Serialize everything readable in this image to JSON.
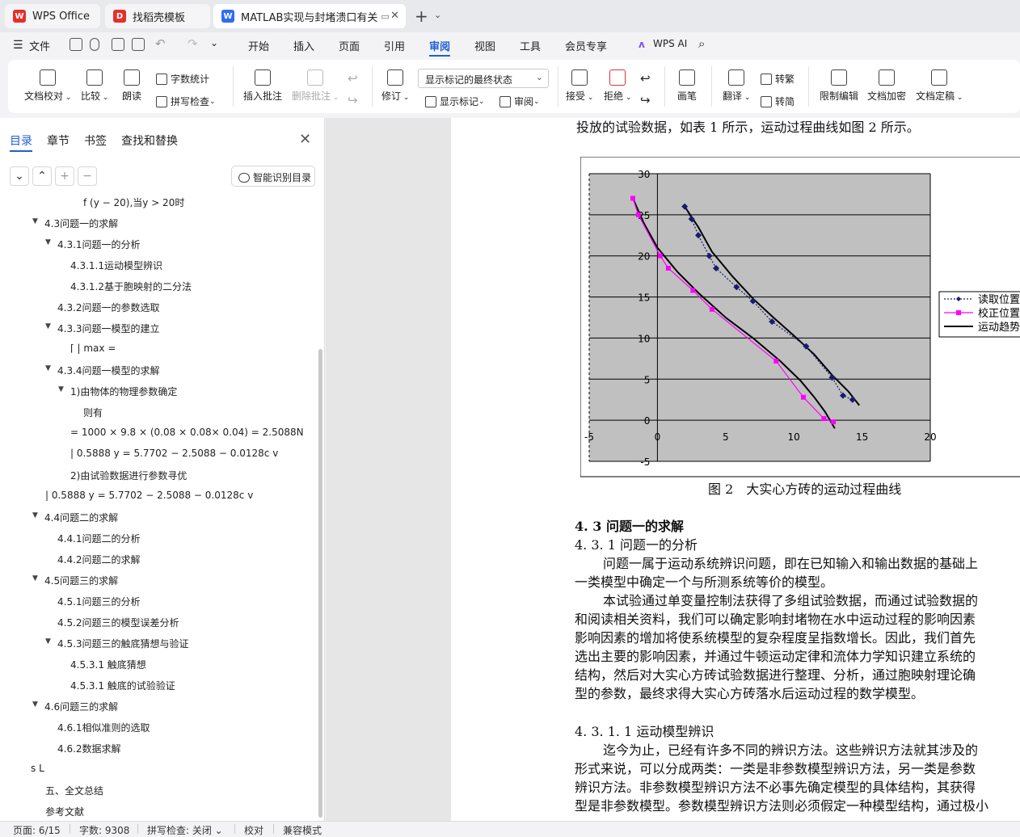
{
  "tabs": [
    {
      "label": "WPS Office",
      "color": "#e5302a"
    },
    {
      "label": "找稻壳模板",
      "color": "#e5302a"
    },
    {
      "label": "MATLAB实现与封堵溃口有关",
      "color": "#2f6cf6"
    }
  ],
  "menu": {
    "file": "文件",
    "items": [
      "开始",
      "插入",
      "页面",
      "引用",
      "审阅",
      "视图",
      "工具",
      "会员专享"
    ],
    "active": "审阅",
    "wps_ai": "WPS AI"
  },
  "ribbon": {
    "doc_check": "文档校对",
    "compare": "比较",
    "read_aloud": "朗读",
    "word_count": "字数统计",
    "spell_check": "拼写检查",
    "insert_comment": "插入批注",
    "delete_comment": "删除批注",
    "revise": "修订",
    "markup_state": "显示标记的最终状态",
    "show_markup": "显示标记",
    "review": "审阅",
    "accept": "接受",
    "reject": "拒绝",
    "pen": "画笔",
    "translate": "翻译",
    "to_trad": "转繁",
    "to_simp": "转简",
    "restrict_edit": "限制编辑",
    "encrypt": "文档加密",
    "finalize": "文档定稿"
  },
  "nav": {
    "tabs": [
      "目录",
      "章节",
      "书签",
      "查找和替换"
    ],
    "active_tab": "目录",
    "smart_toc": "智能识别目录",
    "items": [
      {
        "text": "f (y − 20),当y > 20时",
        "level": 4,
        "arrow": false
      },
      {
        "text": "4.3问题一的求解",
        "level": 1,
        "arrow": true
      },
      {
        "text": "4.3.1问题一的分析",
        "level": 2,
        "arrow": true
      },
      {
        "text": "4.3.1.1运动模型辨识",
        "level": 3,
        "arrow": false
      },
      {
        "text": "4.3.1.2基于胞映射的二分法",
        "level": 3,
        "arrow": false
      },
      {
        "text": "4.3.2问题一的参数选取",
        "level": 2,
        "arrow": false
      },
      {
        "text": "4.3.3问题一模型的建立",
        "level": 2,
        "arrow": true
      },
      {
        "text": "⌈ |    max =",
        "level": 3,
        "arrow": false
      },
      {
        "text": "4.3.4问题一模型的求解",
        "level": 2,
        "arrow": true
      },
      {
        "text": "1)由物体的物理参数确定",
        "level": 3,
        "arrow": true
      },
      {
        "text": "则有",
        "level": 4,
        "arrow": false
      },
      {
        "text": "= 1000 × 9.8 × (0.08 × 0.08× 0.04) = 2.5088N",
        "level": 3,
        "arrow": false
      },
      {
        "text": "|  0.5888  y = 5.7702 − 2.5088 − 0.0128c v",
        "level": 3,
        "arrow": false
      },
      {
        "text": "2)由试验数据进行参数寻优",
        "level": 3,
        "arrow": false
      },
      {
        "text": "|  0.5888   y = 5.7702 − 2.5088 − 0.0128c v",
        "level": 0,
        "arrow": false
      },
      {
        "text": "4.4问题二的求解",
        "level": 1,
        "arrow": true
      },
      {
        "text": "4.4.1问题二的分析",
        "level": 2,
        "arrow": false
      },
      {
        "text": "4.4.2问题二的求解",
        "level": 2,
        "arrow": false
      },
      {
        "text": "4.5问题三的求解",
        "level": 1,
        "arrow": true
      },
      {
        "text": "4.5.1问题三的分析",
        "level": 2,
        "arrow": false
      },
      {
        "text": "4.5.2问题三的模型误差分析",
        "level": 2,
        "arrow": false
      },
      {
        "text": "4.5.3问题三的触底猜想与验证",
        "level": 2,
        "arrow": true
      },
      {
        "text": "4.5.3.1 触底猜想",
        "level": 3,
        "arrow": false
      },
      {
        "text": "4.5.3.1 触底的试验验证",
        "level": 3,
        "arrow": false
      },
      {
        "text": "4.6问题三的求解",
        "level": 1,
        "arrow": true
      },
      {
        "text": "4.6.1相似准则的选取",
        "level": 2,
        "arrow": false
      },
      {
        "text": "4.6.2数据求解",
        "level": 2,
        "arrow": false
      },
      {
        "text": "s L",
        "level": -1,
        "arrow": false
      },
      {
        "text": "五、全文总结",
        "level": 0,
        "arrow": false
      },
      {
        "text": "参考文献",
        "level": 0,
        "arrow": false
      }
    ]
  },
  "doc": {
    "top_line": "投放的试验数据，如表 1 所示，运动过程曲线如图 2 所示。",
    "figure_caption": "图 2　大实心方砖的运动过程曲线",
    "h_4_3": "4. 3 问题一的求解",
    "h_4_3_1": "4. 3. 1 问题一的分析",
    "p1": [
      "问题一属于运动系统辨识问题，即在已知输入和输出数据的基础上",
      "一类模型中确定一个与所测系统等价的模型。"
    ],
    "p2": [
      "本试验通过单变量控制法获得了多组试验数据，而通过试验数据的",
      "和阅读相关资料，我们可以确定影响封堵物在水中运动过程的影响因素",
      "影响因素的增加将使系统模型的复杂程度呈指数增长。因此，我们首先",
      "选出主要的影响因素，并通过牛顿运动定律和流体力学知识建立系统的",
      "结构，然后对大实心方砖试验数据进行整理、分析，通过胞映射理论确",
      "型的参数，最终求得大实心方砖落水后运动过程的数学模型。"
    ],
    "h_4_3_1_1": "4. 3. 1. 1 运动模型辨识",
    "p3": [
      "迄今为止，已经有许多不同的辨识方法。这些辨识方法就其涉及的",
      "形式来说，可以分成两类：一类是非参数模型辨识方法，另一类是参数",
      "辨识方法。非参数模型辨识方法不必事先确定模型的具体结构，其获得",
      "型是非参数模型。参数模型辨识方法则必须假定一种模型结构，通过极小"
    ]
  },
  "chart_data": {
    "type": "line",
    "xlim": [
      -5,
      20
    ],
    "ylim": [
      -5,
      30
    ],
    "x_ticks": [
      "-5",
      "0",
      "5",
      "10",
      "15",
      "20"
    ],
    "y_ticks": [
      "30",
      "25",
      "20",
      "15",
      "10",
      "5",
      "0",
      "-5"
    ],
    "grid": true,
    "legend_position": "right",
    "series": [
      {
        "name": "读取位置",
        "color": "#1a1a6e",
        "x": [
          2.0,
          2.5,
          3.0,
          3.8,
          4.3,
          5.8,
          7.0,
          8.4,
          10.9,
          12.8,
          13.6,
          14.3
        ],
        "y": [
          26.0,
          24.5,
          22.5,
          20.0,
          18.5,
          16.2,
          14.5,
          12.0,
          9.0,
          5.2,
          3.0,
          2.5
        ]
      },
      {
        "name": "校正位置",
        "color": "#ff00ff",
        "x": [
          -1.8,
          -1.4,
          0.2,
          0.8,
          2.6,
          4.0,
          8.7,
          10.7,
          12.2,
          12.9
        ],
        "y": [
          27.0,
          25.0,
          20.0,
          18.5,
          15.8,
          13.5,
          7.2,
          2.8,
          0.2,
          -0.2
        ]
      },
      {
        "name": "运动趋势",
        "color": "#000000",
        "x": [
          -1.8,
          -1.0,
          0.0,
          1.5,
          3.0,
          5.0,
          7.0,
          9.0,
          10.5,
          11.5,
          12.3,
          13.0
        ],
        "y": [
          27.0,
          24.0,
          21.0,
          18.0,
          15.5,
          12.5,
          10.0,
          7.2,
          4.8,
          2.8,
          1.0,
          -1.0
        ]
      },
      {
        "name": "",
        "color": "#000000",
        "x": [
          2.0,
          3.0,
          4.0,
          5.5,
          7.0,
          8.5,
          10.0,
          11.5,
          12.8,
          14.0,
          14.8
        ],
        "y": [
          26.0,
          23.5,
          20.5,
          17.5,
          14.8,
          12.5,
          10.3,
          8.0,
          5.5,
          3.5,
          1.8
        ]
      }
    ]
  },
  "status": {
    "page": "页面: 6/15",
    "words": "字数: 9308",
    "spell": "拼写检查: 关闭",
    "proof": "校对",
    "compat": "兼容模式"
  }
}
